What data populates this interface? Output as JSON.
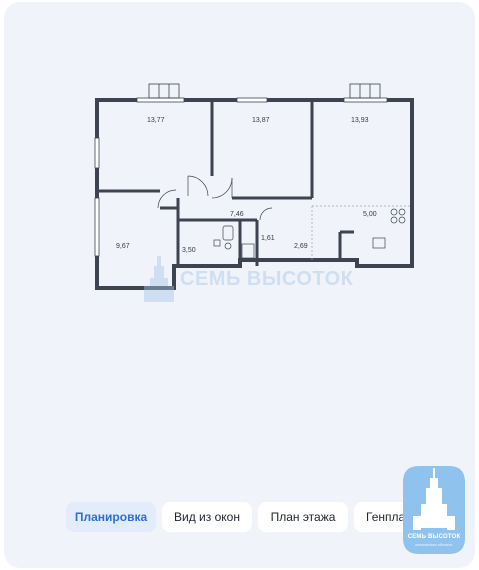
{
  "plan": {
    "rooms": [
      {
        "id": "room-1",
        "area": "13,77"
      },
      {
        "id": "room-2",
        "area": "13,87"
      },
      {
        "id": "room-3",
        "area": "13,93"
      },
      {
        "id": "room-4",
        "area": "9,67"
      },
      {
        "id": "room-5",
        "area": "3,50"
      },
      {
        "id": "room-6",
        "area": "7,46"
      },
      {
        "id": "room-7",
        "area": "1,61"
      },
      {
        "id": "room-8",
        "area": "2,69"
      },
      {
        "id": "room-9",
        "area": "5,00"
      }
    ],
    "wall_color": "#3d4350",
    "window_color": "#ffffff"
  },
  "watermark": {
    "text": "СЕМЬ ВЫСОТОК"
  },
  "tabs": [
    {
      "label": "Планировка",
      "active": true
    },
    {
      "label": "Вид из окон",
      "active": false
    },
    {
      "label": "План этажа",
      "active": false
    },
    {
      "label": "Генплан",
      "active": false
    }
  ],
  "logo": {
    "title": "СЕМЬ ВЫСОТОК",
    "subtitle": "московская область",
    "color": "#8fc3ee"
  },
  "colors": {
    "background": "#f1f3fa",
    "active_tab_text": "#2d6fd6",
    "active_tab_bg": "#e3ecfa"
  }
}
